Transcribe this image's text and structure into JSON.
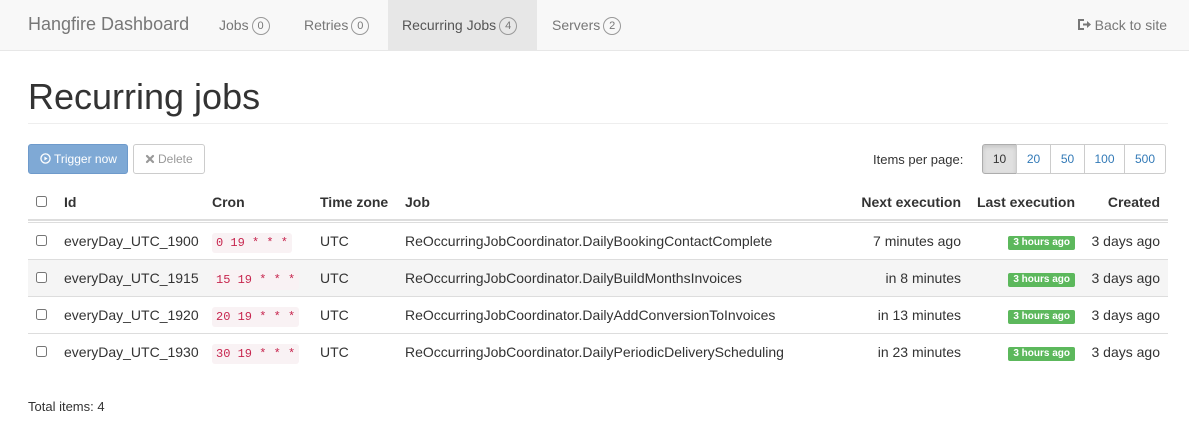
{
  "navbar": {
    "brand": "Hangfire Dashboard",
    "items": [
      {
        "label": "Jobs",
        "count": "0",
        "active": false
      },
      {
        "label": "Retries",
        "count": "0",
        "active": false
      },
      {
        "label": "Recurring Jobs",
        "count": "4",
        "active": true
      },
      {
        "label": "Servers",
        "count": "2",
        "active": false
      }
    ],
    "back_label": "Back to site"
  },
  "page": {
    "title": "Recurring jobs"
  },
  "toolbar": {
    "trigger_label": "Trigger now",
    "delete_label": "Delete",
    "items_per_page_label": "Items per page:",
    "page_sizes": [
      "10",
      "20",
      "50",
      "100",
      "500"
    ],
    "selected_page_size": "10"
  },
  "table": {
    "columns": {
      "id": "Id",
      "cron": "Cron",
      "timezone": "Time zone",
      "job": "Job",
      "next_execution": "Next execution",
      "last_execution": "Last execution",
      "created": "Created"
    },
    "rows": [
      {
        "id": "everyDay_UTC_1900",
        "cron": "0 19 * * *",
        "timezone": "UTC",
        "job": "ReOccurringJobCoordinator.DailyBookingContactComplete",
        "next": "7 minutes ago",
        "last": "3 hours ago",
        "created": "3 days ago"
      },
      {
        "id": "everyDay_UTC_1915",
        "cron": "15 19 * * *",
        "timezone": "UTC",
        "job": "ReOccurringJobCoordinator.DailyBuildMonthsInvoices",
        "next": "in 8 minutes",
        "last": "3 hours ago",
        "created": "3 days ago"
      },
      {
        "id": "everyDay_UTC_1920",
        "cron": "20 19 * * *",
        "timezone": "UTC",
        "job": "ReOccurringJobCoordinator.DailyAddConversionToInvoices",
        "next": "in 13 minutes",
        "last": "3 hours ago",
        "created": "3 days ago"
      },
      {
        "id": "everyDay_UTC_1930",
        "cron": "30 19 * * *",
        "timezone": "UTC",
        "job": "ReOccurringJobCoordinator.DailyPeriodicDeliveryScheduling",
        "next": "in 23 minutes",
        "last": "3 hours ago",
        "created": "3 days ago"
      }
    ]
  },
  "footer": {
    "total_items": "Total items: 4"
  },
  "colors": {
    "primary": "#7fa9d5",
    "success": "#5cb85c",
    "code": "#c7254e",
    "link": "#337ab7"
  }
}
